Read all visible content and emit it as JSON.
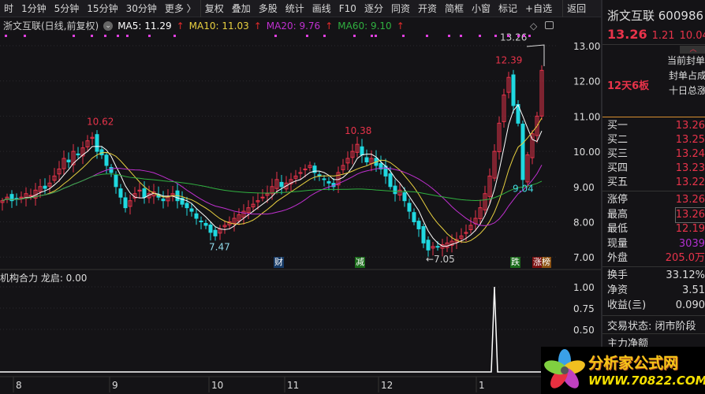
{
  "toolbar": {
    "items": [
      "时",
      "1分钟",
      "5分钟",
      "15分钟",
      "30分钟",
      "更多 〉",
      "复权",
      "叠加",
      "多股",
      "统计",
      "画线",
      "F10",
      "逐分",
      "同资",
      "开资",
      "简框",
      "小窗",
      "标记",
      "+自选",
      "返回"
    ]
  },
  "legend": {
    "title": "浙文互联(日线,前复权)",
    "ma5": "MA5: 11.29",
    "ma10": "MA10: 11.03",
    "ma20": "MA20: 9.76",
    "ma60": "MA60: 9.10",
    "arrow": "↑"
  },
  "colors": {
    "ma5": "#ffffff",
    "ma10": "#e8d040",
    "ma20": "#c030d0",
    "ma60": "#30b040",
    "up": "#e8334a",
    "down": "#20d8e0"
  },
  "chart_data": {
    "type": "candlestick",
    "closes": [
      8.6,
      8.7,
      8.6,
      8.65,
      8.7,
      8.8,
      8.75,
      8.9,
      9.0,
      8.95,
      9.1,
      9.3,
      9.5,
      9.8,
      9.7,
      10.0,
      9.9,
      10.1,
      10.3,
      10.4,
      10.0,
      9.9,
      9.6,
      9.4,
      9.0,
      8.7,
      8.4,
      8.6,
      8.8,
      8.9,
      8.7,
      8.8,
      8.85,
      8.7,
      8.6,
      8.7,
      8.8,
      8.6,
      8.5,
      8.4,
      8.3,
      8.1,
      8.0,
      7.9,
      7.7,
      7.6,
      7.8,
      7.9,
      8.0,
      8.1,
      8.2,
      8.3,
      8.4,
      8.5,
      8.6,
      8.7,
      8.8,
      9.0,
      9.2,
      9.0,
      9.1,
      9.2,
      9.3,
      9.4,
      9.5,
      9.6,
      9.4,
      9.3,
      9.2,
      9.1,
      9.0,
      9.4,
      9.6,
      9.8,
      10.0,
      10.2,
      9.9,
      9.7,
      9.8,
      9.6,
      9.5,
      9.3,
      9.0,
      8.8,
      8.9,
      8.6,
      8.3,
      8.0,
      7.8,
      7.4,
      7.2,
      7.3,
      7.3,
      7.35,
      7.4,
      7.45,
      7.5,
      7.6,
      7.7,
      7.9,
      8.1,
      8.4,
      8.8,
      9.3,
      10.0,
      10.8,
      11.6,
      12.1,
      11.3,
      10.8,
      9.2,
      9.9,
      10.5,
      11.0,
      12.3
    ],
    "ylim": [
      6.6,
      13.4
    ],
    "yticks": [
      "13.00",
      "12.00",
      "11.00",
      "10.00",
      "9.00",
      "8.00",
      "7.00"
    ],
    "annotations": {
      "high1": "10.62",
      "low1": "7.47",
      "high2": "10.38",
      "low2": "←7.05",
      "high3": "12.39",
      "ma60_label": "9.04",
      "limit": "13.26"
    },
    "xticks": [
      "8",
      "9",
      "10",
      "11",
      "12",
      "1"
    ],
    "indicator": {
      "label": "机构合力 龙启: 0.00",
      "yticks": [
        "1.00",
        "0.75",
        "0.50"
      ],
      "spike_index": 104,
      "spike_value": 1.0
    }
  },
  "markers": [
    "财",
    "减",
    "跌",
    "涨榜"
  ],
  "quote": {
    "name": "浙文互联 600986",
    "price": "13.26",
    "change": "1.21",
    "pct": "10.04",
    "board": "12天6板",
    "seal1": "当前封单",
    "seal2": "封单占成",
    "seal3": "十日总涨",
    "bids": [
      {
        "k": "买一",
        "v": "13.26"
      },
      {
        "k": "买二",
        "v": "13.25"
      },
      {
        "k": "买三",
        "v": "13.24"
      },
      {
        "k": "买四",
        "v": "13.23"
      },
      {
        "k": "买五",
        "v": "13.22"
      }
    ],
    "stats": [
      {
        "k": "涨停",
        "v": "13.26"
      },
      {
        "k": "最高",
        "v": "13.26"
      },
      {
        "k": "最低",
        "v": "12.19"
      },
      {
        "k": "现量",
        "v": "3039"
      },
      {
        "k": "外盘",
        "v": "205.0万"
      }
    ],
    "fund": [
      {
        "k": "换手",
        "v": "33.12%"
      },
      {
        "k": "净资",
        "v": "3.51"
      },
      {
        "k": "收益(亖)",
        "v": "0.090"
      }
    ],
    "status": "交易状态: 闭市阶段",
    "main_net": "主力净额"
  },
  "logo": {
    "name": "分析家公式网",
    "url": "WWW.70822.COM"
  }
}
